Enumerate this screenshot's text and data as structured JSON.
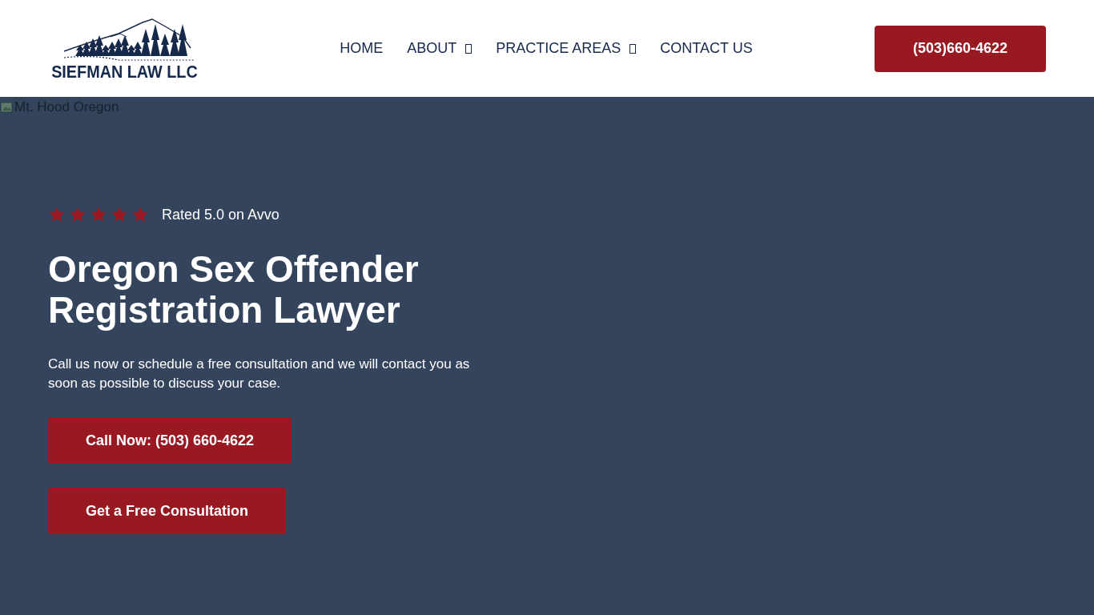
{
  "header": {
    "logo": {
      "text": "SIEFMAN LAW LLC"
    },
    "nav": [
      {
        "label": "HOME",
        "dropdown": false
      },
      {
        "label": "ABOUT",
        "dropdown": true
      },
      {
        "label": "PRACTICE AREAS",
        "dropdown": true
      },
      {
        "label": "CONTACT US",
        "dropdown": false
      }
    ],
    "phone_button": "(503)660-4622"
  },
  "hero": {
    "image_alt": "Mt. Hood Oregon",
    "rating": {
      "stars": 5,
      "text": "Rated 5.0 on Avvo"
    },
    "title": "Oregon Sex Offender Registration Lawyer",
    "description": "Call us now or schedule a free consultation and we will contact you as soon as possible to discuss your case.",
    "buttons": [
      "Call Now: (503) 660-4622",
      "Get a Free Consultation"
    ]
  }
}
